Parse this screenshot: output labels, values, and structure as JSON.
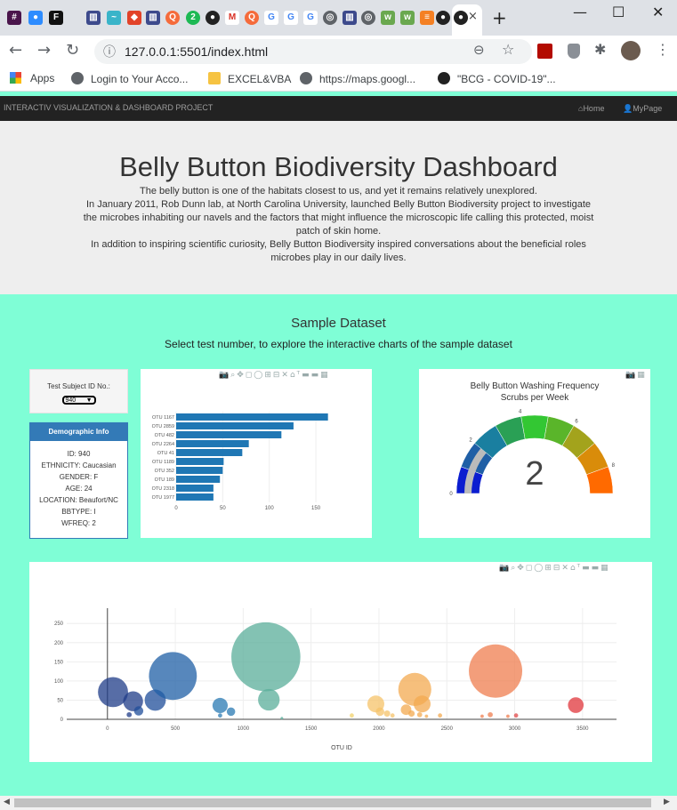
{
  "browser": {
    "url": "127.0.0.1:5501/index.html",
    "bookmarks": [
      "Apps",
      "Login to Your Acco...",
      "EXCEL&VBA",
      "https://maps.googl...",
      "\"BCG - COVID-19\"..."
    ]
  },
  "navbar": {
    "brand": "INTERACTIV VISUALIZATION & DASHBOARD PROJECT",
    "home": "Home",
    "mypage": "MyPage"
  },
  "header": {
    "title": "Belly Button Biodiversity Dashboard",
    "p1": "The belly button is one of the habitats closest to us, and yet it remains relatively unexplored.",
    "p2": "In January 2011, Rob Dunn lab, at North Carolina University, launched Belly Button Biodiversity project to investigate the microbes inhabiting our navels and the factors that might influence the microscopic life calling this protected, moist patch of skin home.",
    "p3": "In addition to inspiring scientific curiosity, Belly Button Biodiversity inspired conversations about the beneficial roles microbes play in our daily lives."
  },
  "section": {
    "title": "Sample Dataset",
    "subtitle": "Select test number, to explore the interactive charts of the sample dataset"
  },
  "selector": {
    "label": "Test Subject ID No.:",
    "value": "940"
  },
  "demographic": {
    "title": "Demographic Info",
    "lines": [
      "ID: 940",
      "ETHNICITY: Caucasian",
      "GENDER: F",
      "AGE: 24",
      "LOCATION: Beaufort/NC",
      "BBTYPE: I",
      "WFREQ: 2"
    ]
  },
  "chart_data": [
    {
      "type": "bar",
      "orientation": "horizontal",
      "categories": [
        "OTU 1167",
        "OTU 2859",
        "OTU 482",
        "OTU 2264",
        "OTU 41",
        "OTU 1189",
        "OTU 352",
        "OTU 189",
        "OTU 2318",
        "OTU 1977"
      ],
      "values": [
        163,
        126,
        113,
        78,
        71,
        51,
        50,
        47,
        40,
        40
      ],
      "xticks": [
        0,
        50,
        100,
        150
      ],
      "xlim": [
        0,
        170
      ],
      "color": "#1f77b4"
    },
    {
      "type": "gauge",
      "title": "Belly Button Washing Frequency",
      "subtitle": "Scrubs per Week",
      "value": 2,
      "range": [
        0,
        9
      ],
      "tick_labels": [
        "0",
        "2",
        "4",
        "6",
        "8"
      ],
      "segment_colors": [
        "#0b1dd0",
        "#1f5fa6",
        "#1a7fa0",
        "#2aa055",
        "#33c733",
        "#5ab52a",
        "#a3a31c",
        "#d98c0a",
        "#ff6a00"
      ]
    },
    {
      "type": "scatter",
      "style": "bubble",
      "xlabel": "OTU ID",
      "xticks": [
        0,
        500,
        1000,
        1500,
        2000,
        2500,
        3000,
        3500
      ],
      "yticks": [
        0,
        50,
        100,
        150,
        200,
        250
      ],
      "xlim": [
        -300,
        3750
      ],
      "ylim": [
        0,
        290
      ],
      "points": [
        {
          "x": 41,
          "y": 71,
          "s": 71,
          "c": "#1f3c88"
        },
        {
          "x": 189,
          "y": 47,
          "s": 47,
          "c": "#1f3c88"
        },
        {
          "x": 160,
          "y": 12,
          "s": 12,
          "c": "#1f3c88"
        },
        {
          "x": 230,
          "y": 22,
          "s": 22,
          "c": "#1f4d99"
        },
        {
          "x": 352,
          "y": 50,
          "s": 50,
          "c": "#1f4d99"
        },
        {
          "x": 482,
          "y": 113,
          "s": 113,
          "c": "#1f5fa6"
        },
        {
          "x": 830,
          "y": 36,
          "s": 36,
          "c": "#2a7ab3"
        },
        {
          "x": 910,
          "y": 20,
          "s": 20,
          "c": "#2a7ab3"
        },
        {
          "x": 830,
          "y": 10,
          "s": 10,
          "c": "#2a7ab3"
        },
        {
          "x": 1167,
          "y": 163,
          "s": 163,
          "c": "#5aae9a"
        },
        {
          "x": 1189,
          "y": 51,
          "s": 51,
          "c": "#5aae9a"
        },
        {
          "x": 1285,
          "y": 3,
          "s": 3,
          "c": "#5aae9a"
        },
        {
          "x": 1800,
          "y": 10,
          "s": 10,
          "c": "#f2d16b"
        },
        {
          "x": 1977,
          "y": 40,
          "s": 40,
          "c": "#f5c36a"
        },
        {
          "x": 2008,
          "y": 20,
          "s": 20,
          "c": "#f5c36a"
        },
        {
          "x": 2060,
          "y": 15,
          "s": 15,
          "c": "#f5c36a"
        },
        {
          "x": 2100,
          "y": 10,
          "s": 10,
          "c": "#f5c36a"
        },
        {
          "x": 2200,
          "y": 25,
          "s": 25,
          "c": "#f3a950"
        },
        {
          "x": 2264,
          "y": 78,
          "s": 78,
          "c": "#f3a950"
        },
        {
          "x": 2318,
          "y": 40,
          "s": 40,
          "c": "#f3a950"
        },
        {
          "x": 2240,
          "y": 15,
          "s": 15,
          "c": "#f3a950"
        },
        {
          "x": 2300,
          "y": 12,
          "s": 12,
          "c": "#f3a950"
        },
        {
          "x": 2350,
          "y": 8,
          "s": 8,
          "c": "#f3a950"
        },
        {
          "x": 2450,
          "y": 10,
          "s": 10,
          "c": "#f3a950"
        },
        {
          "x": 2760,
          "y": 8,
          "s": 8,
          "c": "#ef7d4f"
        },
        {
          "x": 2820,
          "y": 12,
          "s": 12,
          "c": "#ef7d4f"
        },
        {
          "x": 2859,
          "y": 126,
          "s": 126,
          "c": "#ef7d4f"
        },
        {
          "x": 2950,
          "y": 8,
          "s": 8,
          "c": "#ef7d4f"
        },
        {
          "x": 3010,
          "y": 10,
          "s": 10,
          "c": "#e04848"
        },
        {
          "x": 3450,
          "y": 37,
          "s": 37,
          "c": "#e0353b"
        }
      ]
    }
  ]
}
